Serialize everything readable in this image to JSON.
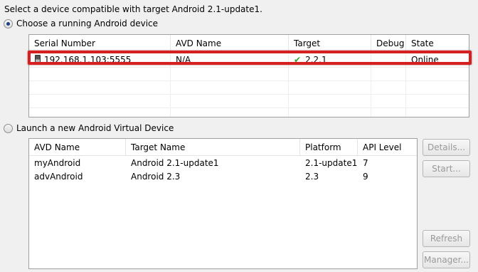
{
  "prompt": "Select a device compatible with target Android 2.1-update1.",
  "running_option": {
    "label": "Choose a running Android device",
    "selected": true
  },
  "device_table": {
    "columns": [
      "Serial Number",
      "AVD Name",
      "Target",
      "Debug",
      "State"
    ],
    "rows": [
      {
        "serial": "192.168.1.103:5555",
        "avd_name": "N/A",
        "target": "2.2.1",
        "debug": "",
        "state": "Online"
      }
    ]
  },
  "launch_option": {
    "label": "Launch a new Android Virtual Device",
    "selected": false
  },
  "avd_table": {
    "columns": [
      "AVD Name",
      "Target Name",
      "Platform",
      "API Level"
    ],
    "rows": [
      {
        "name": "myAndroid",
        "target": "Android 2.1-update1",
        "platform": "2.1-update1",
        "api": "7"
      },
      {
        "name": "advAndroid",
        "target": "Android 2.3",
        "platform": "2.3",
        "api": "9"
      }
    ]
  },
  "buttons": {
    "details": "Details...",
    "start": "Start...",
    "refresh": "Refresh",
    "manager": "Manager..."
  },
  "icons": {
    "device": "phone-icon",
    "target_ok": "checkmark-icon"
  },
  "colors": {
    "highlight": "#d42020",
    "check": "#2aa52a",
    "selection_dot": "#1c3f87"
  }
}
